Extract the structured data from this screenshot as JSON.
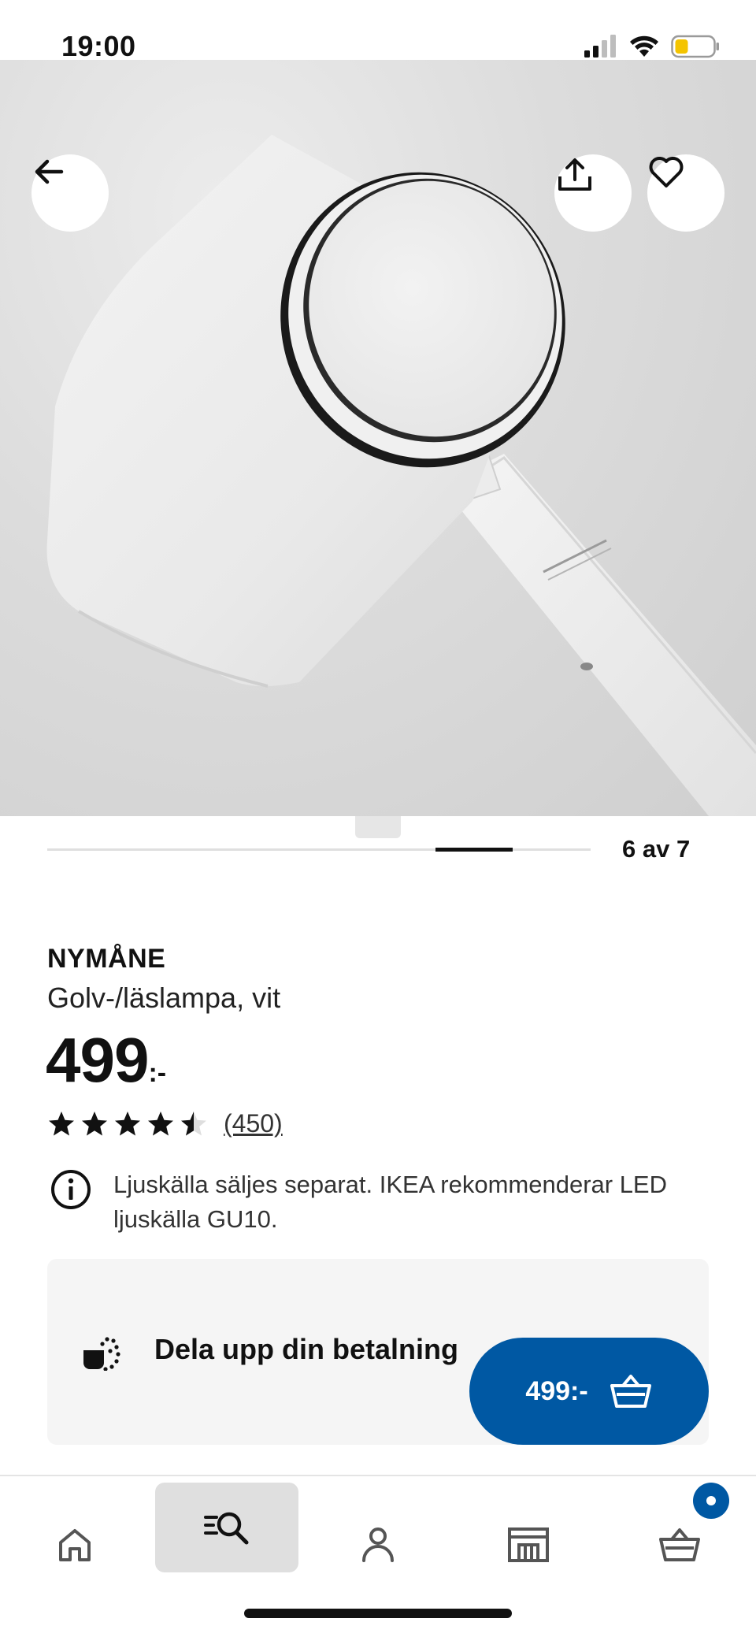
{
  "status_bar": {
    "time": "19:00"
  },
  "carousel": {
    "counter": "6 av 7",
    "current": 6,
    "total": 7
  },
  "product": {
    "name": "NYMÅNE",
    "description": "Golv-/läslampa, vit",
    "price_integer": "499",
    "price_suffix": ":-",
    "rating": 4.5,
    "rating_max": 5,
    "review_count": "(450)"
  },
  "notice": {
    "text": "Ljuskälla säljes separat. IKEA rekommenderar LED ljuskälla GU10.",
    "icon": "info-icon"
  },
  "payment_card": {
    "text": "Dela upp din betalning",
    "icon": "payment-split-icon"
  },
  "buy_button": {
    "price": "499:-",
    "icon": "basket-icon"
  },
  "bottom_nav": {
    "items": [
      {
        "name": "home",
        "icon": "home-icon"
      },
      {
        "name": "search",
        "icon": "search-icon",
        "active": true
      },
      {
        "name": "profile",
        "icon": "profile-icon"
      },
      {
        "name": "stores",
        "icon": "store-icon"
      },
      {
        "name": "cart",
        "icon": "cart-icon",
        "badge": true
      }
    ]
  },
  "colors": {
    "brand_blue": "#0058a3",
    "text": "#111111",
    "card_bg": "#f5f5f5",
    "active_nav_bg": "#dfdfdf"
  }
}
